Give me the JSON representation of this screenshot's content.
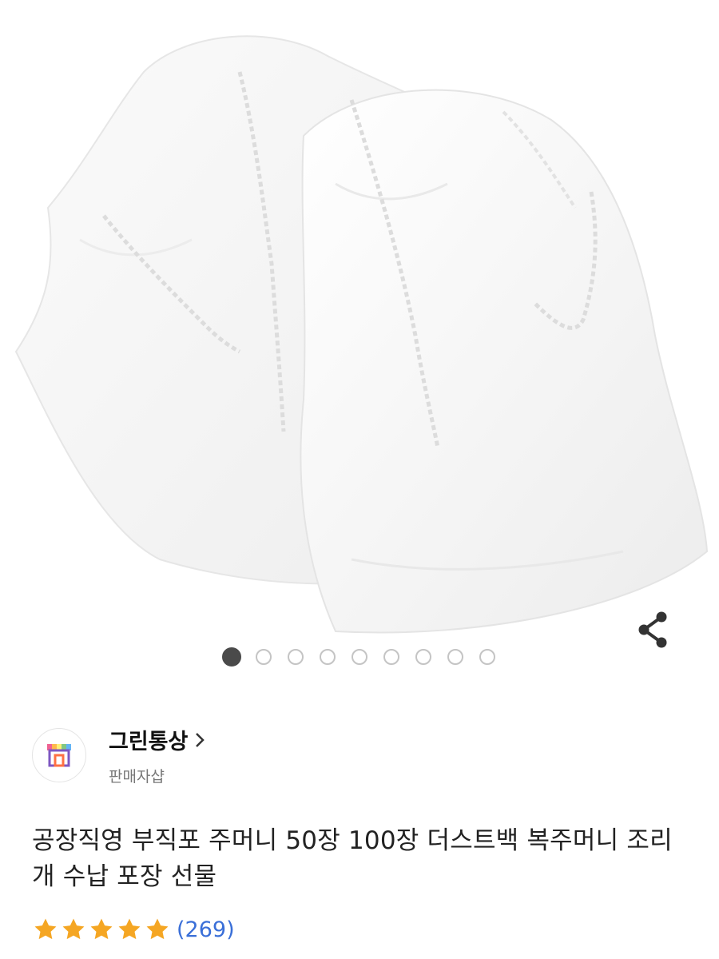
{
  "gallery": {
    "image_alt": "white drawstring pouches",
    "dot_count": 9,
    "active_index": 0,
    "share_icon": "share-icon"
  },
  "seller": {
    "name": "그린통상",
    "subtitle": "판매자샵",
    "avatar_icon": "storefront-icon"
  },
  "product": {
    "title": "공장직영 부직포 주머니 50장 100장 더스트백 복주머니 조리개 수납 포장 선물",
    "rating_stars": 5,
    "review_count": "(269)"
  },
  "colors": {
    "star": "#f5a623",
    "review_link": "#3a6fd8",
    "active_dot": "#4a4a4a"
  }
}
